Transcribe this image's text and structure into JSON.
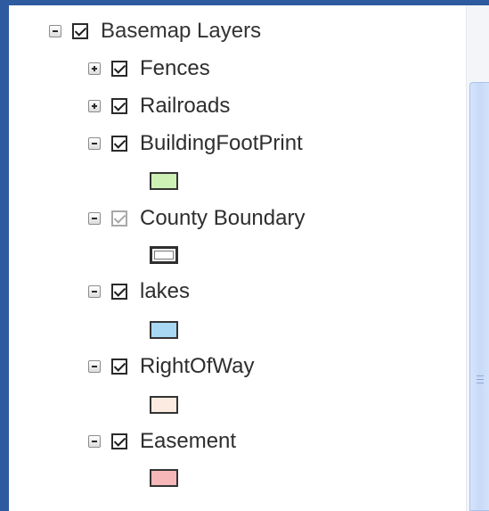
{
  "tree": {
    "root": {
      "label": "Basemap Layers",
      "expanded": true,
      "checked": true
    },
    "layers": [
      {
        "label": "Fences",
        "expanded": false,
        "checked": true,
        "checkbox_style": "normal"
      },
      {
        "label": "Railroads",
        "expanded": false,
        "checked": true,
        "checkbox_style": "normal"
      },
      {
        "label": "BuildingFootPrint",
        "expanded": true,
        "checked": true,
        "checkbox_style": "normal",
        "legend_color": "#cdf0b4",
        "legend_style": "fill"
      },
      {
        "label": "County Boundary",
        "expanded": true,
        "checked": true,
        "checkbox_style": "dimmed",
        "legend_color": "#2f2f2f",
        "legend_style": "outline"
      },
      {
        "label": "lakes",
        "expanded": true,
        "checked": true,
        "checkbox_style": "normal",
        "legend_color": "#a8d8f4",
        "legend_style": "fill"
      },
      {
        "label": "RightOfWay",
        "expanded": true,
        "checked": true,
        "checkbox_style": "normal",
        "legend_color": "#fcebe0",
        "legend_style": "fill"
      },
      {
        "label": "Easement",
        "expanded": true,
        "checked": true,
        "checkbox_style": "normal",
        "legend_color": "#f5b7b7",
        "legend_style": "fill"
      }
    ]
  },
  "colors": {
    "frame": "#2e5aa0",
    "scroll_thumb": "#c8daf8"
  }
}
